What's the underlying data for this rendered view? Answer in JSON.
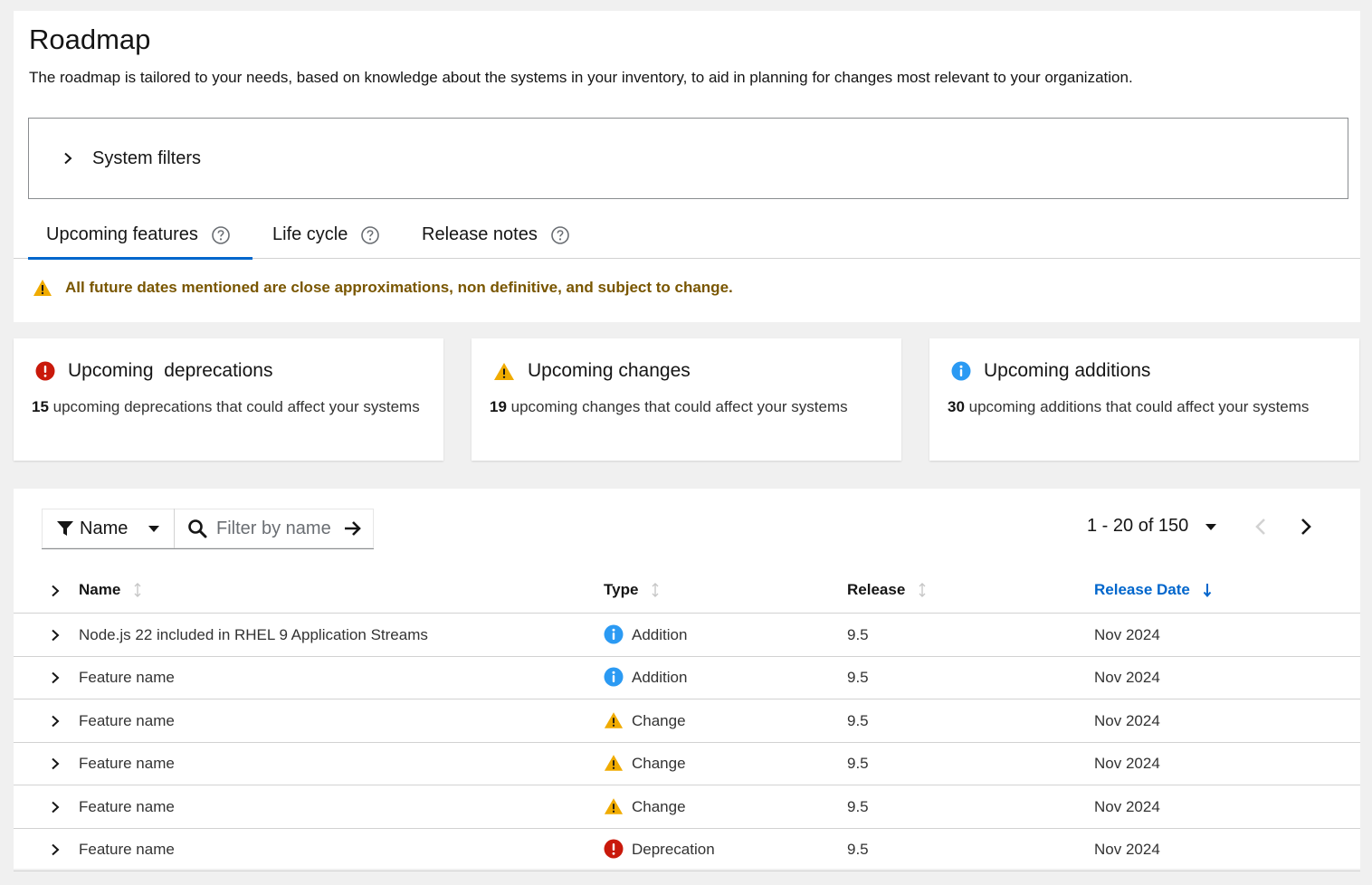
{
  "page": {
    "title": "Roadmap",
    "description": "The roadmap is tailored to your needs, based on knowledge about the systems in your inventory, to aid in planning for changes most relevant to your organization."
  },
  "filters": {
    "label": "System filters"
  },
  "tabs": [
    {
      "label": "Upcoming features",
      "active": true
    },
    {
      "label": "Life cycle",
      "active": false
    },
    {
      "label": "Release notes",
      "active": false
    }
  ],
  "alert": {
    "text": "All future dates mentioned are close approximations, non definitive, and subject to change."
  },
  "cards": [
    {
      "title": "Upcoming  deprecations",
      "count": "15",
      "text": " upcoming deprecations that could affect your systems",
      "icon": "exclamation-circle-icon"
    },
    {
      "title": "Upcoming changes",
      "count": "19",
      "text": " upcoming changes that could affect your systems",
      "icon": "warning-triangle-icon"
    },
    {
      "title": "Upcoming additions",
      "count": "30",
      "text": " upcoming additions that could affect your systems",
      "icon": "info-circle-icon"
    }
  ],
  "toolbar": {
    "filter_by": "Name",
    "search_placeholder": "Filter by name",
    "pagination": "1 - 20 of 150"
  },
  "table": {
    "columns": [
      "Name",
      "Type",
      "Release",
      "Release Date"
    ],
    "sorted_column": "Release Date",
    "rows": [
      {
        "name": "Node.js 22 included in RHEL 9 Application Streams",
        "type": "Addition",
        "release": "9.5",
        "date": "Nov 2024"
      },
      {
        "name": "Feature name",
        "type": "Addition",
        "release": "9.5",
        "date": "Nov 2024"
      },
      {
        "name": "Feature name",
        "type": "Change",
        "release": "9.5",
        "date": "Nov 2024"
      },
      {
        "name": "Feature name",
        "type": "Change",
        "release": "9.5",
        "date": "Nov 2024"
      },
      {
        "name": "Feature name",
        "type": "Change",
        "release": "9.5",
        "date": "Nov 2024"
      },
      {
        "name": "Feature name",
        "type": "Deprecation",
        "release": "9.5",
        "date": "Nov 2024"
      }
    ]
  },
  "colors": {
    "accent": "#0066cc",
    "danger": "#c9190b",
    "warning": "#f0ab00",
    "info": "#2b9af3",
    "warning_text": "#795600"
  }
}
